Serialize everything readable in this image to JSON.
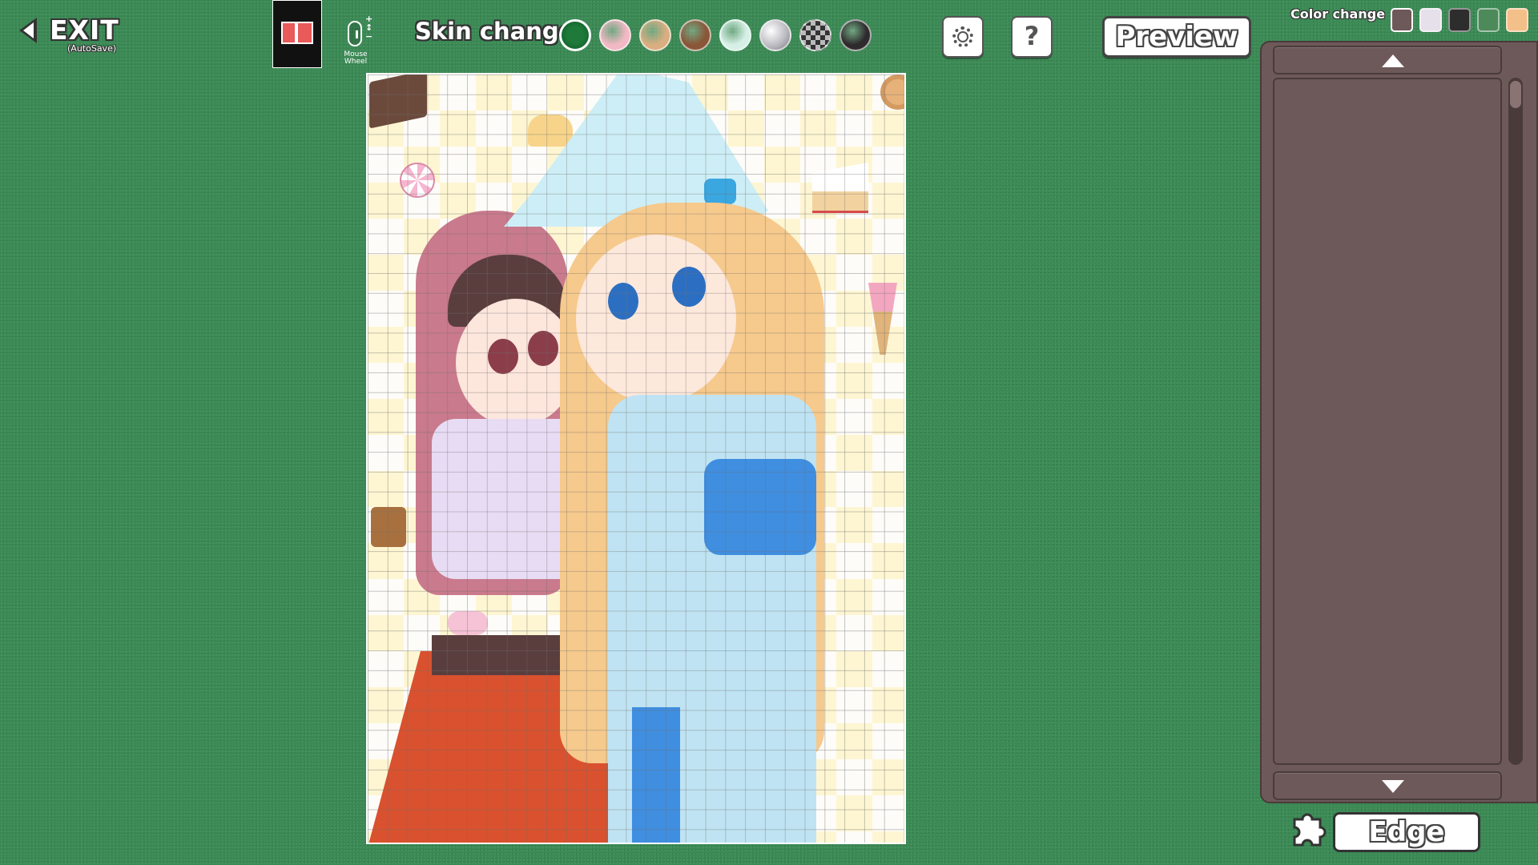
{
  "header": {
    "exit_label": "EXIT",
    "exit_sub": "(AutoSave)",
    "wheel_caption": "Mouse Wheel",
    "wheel_plus": "+",
    "wheel_minus": "−",
    "skin_label": "Skin change",
    "preview_label": "Preview",
    "help_label": "?",
    "color_label": "Color change"
  },
  "skins": [
    {
      "name": "green-felt",
      "color": "#1f7a3a"
    },
    {
      "name": "pink",
      "color": "#f2b8c4"
    },
    {
      "name": "beige",
      "color": "#d9ae80"
    },
    {
      "name": "brown",
      "color": "#8a5638"
    },
    {
      "name": "mint",
      "color": "#d6f0e6"
    },
    {
      "name": "silver",
      "color": "#b6b6bd"
    },
    {
      "name": "checker",
      "color": "#555555"
    },
    {
      "name": "dark",
      "color": "#2f2a2d"
    }
  ],
  "panel_colors": [
    {
      "name": "mauve",
      "color": "#6d5959"
    },
    {
      "name": "light",
      "color": "#e6e0ea"
    },
    {
      "name": "dark",
      "color": "#2d2d2d"
    },
    {
      "name": "green",
      "color": "#4d8a5a"
    },
    {
      "name": "tan",
      "color": "#f2c088"
    }
  ],
  "panel": {
    "edge_label": "Edge"
  }
}
